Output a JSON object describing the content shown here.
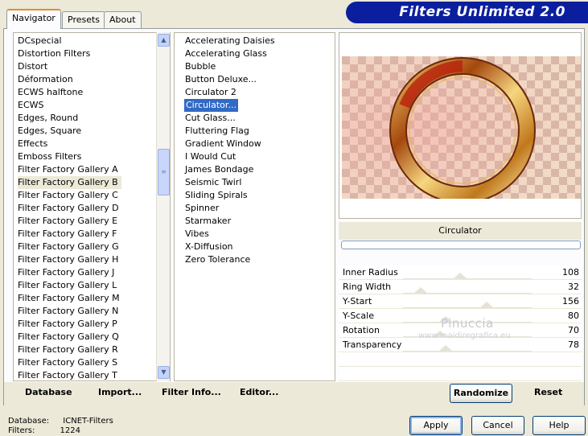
{
  "app": {
    "title": "Filters Unlimited 2.0"
  },
  "tabs": [
    {
      "label": "Navigator",
      "active": true
    },
    {
      "label": "Presets",
      "active": false
    },
    {
      "label": "About",
      "active": false
    }
  ],
  "categories": {
    "items": [
      "DCspecial",
      "Distortion Filters",
      "Distort",
      "Déformation",
      "ECWS halftone",
      "ECWS",
      "Edges, Round",
      "Edges, Square",
      "Effects",
      "Emboss Filters",
      "Filter Factory Gallery A",
      "Filter Factory Gallery B",
      "Filter Factory Gallery C",
      "Filter Factory Gallery D",
      "Filter Factory Gallery E",
      "Filter Factory Gallery F",
      "Filter Factory Gallery G",
      "Filter Factory Gallery H",
      "Filter Factory Gallery J",
      "Filter Factory Gallery L",
      "Filter Factory Gallery M",
      "Filter Factory Gallery N",
      "Filter Factory Gallery P",
      "Filter Factory Gallery Q",
      "Filter Factory Gallery R",
      "Filter Factory Gallery S",
      "Filter Factory Gallery T"
    ],
    "selected": "Filter Factory Gallery B"
  },
  "filters": {
    "items": [
      "Accelerating Daisies",
      "Accelerating Glass",
      "Bubble",
      "Button Deluxe...",
      "Circulator 2",
      "Circulator...",
      "Cut Glass...",
      "Fluttering Flag",
      "Gradient Window",
      "I Would Cut",
      "James Bondage",
      "Seismic Twirl",
      "Sliding Spirals",
      "Spinner",
      "Starmaker",
      "Vibes",
      "X-Diffusion",
      "Zero Tolerance"
    ],
    "selected": "Circulator..."
  },
  "preview": {
    "filter_name": "Circulator",
    "progress": 0
  },
  "params": [
    {
      "label": "Inner Radius",
      "value": "108",
      "level": 0.42
    },
    {
      "label": "Ring Width",
      "value": "32",
      "level": 0.13
    },
    {
      "label": "Y-Start",
      "value": "156",
      "level": 0.61
    },
    {
      "label": "Y-Scale",
      "value": "80",
      "level": 0.31
    },
    {
      "label": "Rotation",
      "value": "70",
      "level": 0.27
    },
    {
      "label": "Transparency",
      "value": "78",
      "level": 0.31
    }
  ],
  "watermark": {
    "line1": "Pinuccia",
    "line2": "www.maidiregrafica.eu"
  },
  "toolbar": {
    "database": "Database",
    "import": "Import...",
    "filter_info": "Filter Info...",
    "editor": "Editor...",
    "randomize": "Randomize",
    "reset": "Reset"
  },
  "status": {
    "database_label": "Database:",
    "database_value": "ICNET-Filters",
    "filters_label": "Filters:",
    "filters_value": "1224"
  },
  "buttons": {
    "apply": "Apply",
    "cancel": "Cancel",
    "help": "Help"
  },
  "icons": {
    "scroll_up": "chevron-up-icon",
    "scroll_down": "chevron-down-icon",
    "scroll_grip": "grip-icon"
  },
  "colors": {
    "banner": "#0b1f9e",
    "selection": "#316ac5",
    "tab_accent": "#e68b2c"
  }
}
